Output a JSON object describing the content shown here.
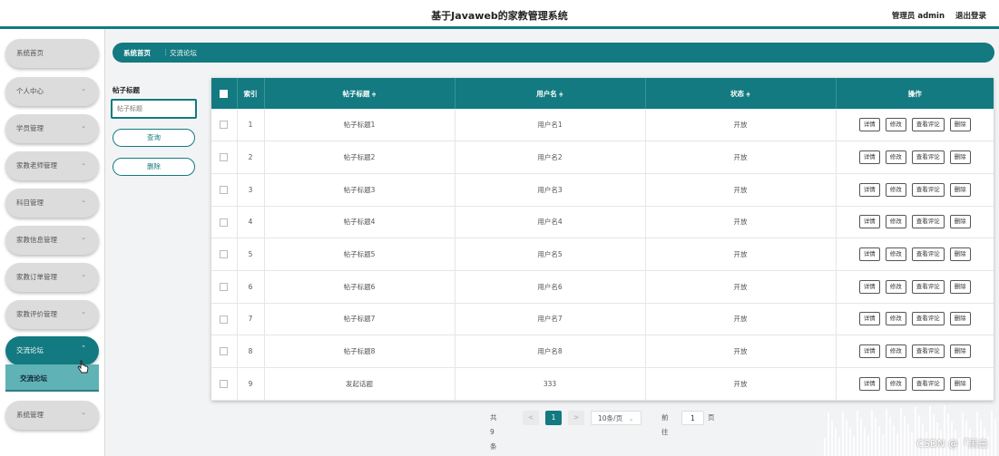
{
  "header": {
    "title": "基于Javaweb的家教管理系统",
    "admin_label": "管理员 admin",
    "logout_label": "退出登录"
  },
  "sidebar": {
    "items": [
      {
        "label": "系统首页",
        "has_chevron": false
      },
      {
        "label": "个人中心",
        "has_chevron": true
      },
      {
        "label": "学员管理",
        "has_chevron": true
      },
      {
        "label": "家教老师管理",
        "has_chevron": true
      },
      {
        "label": "科目管理",
        "has_chevron": true
      },
      {
        "label": "家教信息管理",
        "has_chevron": true
      },
      {
        "label": "家教订单管理",
        "has_chevron": true
      },
      {
        "label": "家教评价管理",
        "has_chevron": true
      },
      {
        "label": "交流论坛",
        "has_chevron": true,
        "active": true
      },
      {
        "label": "系统管理",
        "has_chevron": true
      }
    ],
    "submenu": {
      "label": "交流论坛"
    }
  },
  "breadcrumb": {
    "home": "系统首页",
    "separator": "⋮",
    "current": "交流论坛"
  },
  "search": {
    "label": "帖子标题",
    "placeholder": "帖子标题",
    "query_button": "查询",
    "delete_button": "删除"
  },
  "table": {
    "columns": {
      "index": "索引",
      "title": "帖子标题",
      "username": "用户名",
      "status": "状态",
      "actions": "操作"
    },
    "sort_glyph": "≑",
    "action_labels": {
      "detail": "详情",
      "edit": "修改",
      "comments": "查看评论",
      "delete": "删除"
    },
    "rows": [
      {
        "index": "1",
        "title": "帖子标题1",
        "username": "用户名1",
        "status": "开放"
      },
      {
        "index": "2",
        "title": "帖子标题2",
        "username": "用户名2",
        "status": "开放"
      },
      {
        "index": "3",
        "title": "帖子标题3",
        "username": "用户名3",
        "status": "开放"
      },
      {
        "index": "4",
        "title": "帖子标题4",
        "username": "用户名4",
        "status": "开放"
      },
      {
        "index": "5",
        "title": "帖子标题5",
        "username": "用户名5",
        "status": "开放"
      },
      {
        "index": "6",
        "title": "帖子标题6",
        "username": "用户名6",
        "status": "开放"
      },
      {
        "index": "7",
        "title": "帖子标题7",
        "username": "用户名7",
        "status": "开放"
      },
      {
        "index": "8",
        "title": "帖子标题8",
        "username": "用户名8",
        "status": "开放"
      },
      {
        "index": "9",
        "title": "发起话题",
        "username": "333",
        "status": "开放"
      }
    ]
  },
  "pagination": {
    "total": "共 9 条",
    "prev": "<",
    "current_page": "1",
    "next": ">",
    "page_size": "10条/页",
    "page_size_chevron": "⌄",
    "jump_prefix": "前往",
    "jump_value": "1",
    "jump_suffix": "页"
  },
  "watermark": "CSDN @「黑白",
  "colors": {
    "primary": "#127a80",
    "submenu": "#5fb2b5",
    "menu_inactive": "#dcdcdc"
  },
  "icons": {
    "chevron_down": "chevron-down-icon",
    "chevron_up": "chevron-up-icon",
    "cursor": "hand-pointer-icon"
  }
}
